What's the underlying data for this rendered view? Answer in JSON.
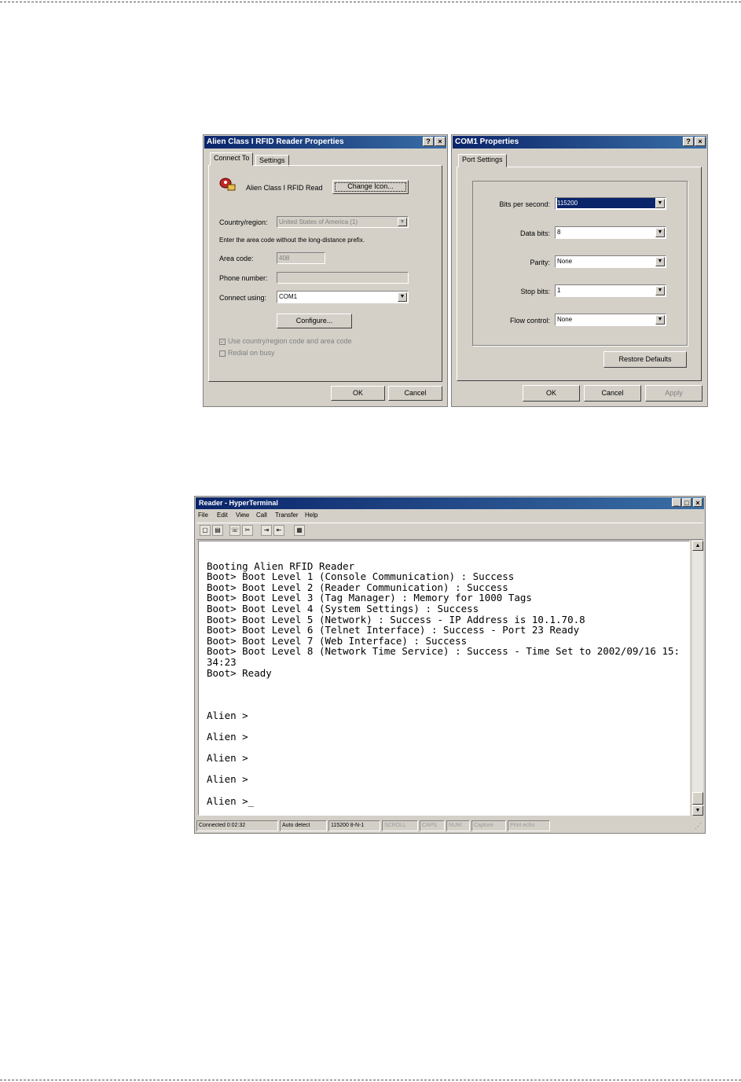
{
  "props_dialog": {
    "title": "Alien Class I RFID Reader Properties",
    "help_btn": "?",
    "close_btn": "×",
    "tabs": [
      "Connect To",
      "Settings"
    ],
    "connection_name": "Alien Class I RFID Read",
    "change_icon_label": "Change Icon...",
    "country_label": "Country/region:",
    "country_value": "United States of America (1)",
    "hint": "Enter the area code without the long-distance prefix.",
    "area_code_label": "Area code:",
    "area_code_value": "408",
    "phone_label": "Phone number:",
    "phone_value": "",
    "connect_using_label": "Connect using:",
    "connect_using_value": "COM1",
    "configure_label": "Configure...",
    "use_country_label": "Use country/region code and area code",
    "redial_label": "Redial on busy",
    "ok_label": "OK",
    "cancel_label": "Cancel"
  },
  "com_dialog": {
    "title": "COM1 Properties",
    "help_btn": "?",
    "close_btn": "×",
    "tab": "Port Settings",
    "fields": [
      {
        "label": "Bits per second:",
        "value": "115200"
      },
      {
        "label": "Data bits:",
        "value": "8"
      },
      {
        "label": "Parity:",
        "value": "None"
      },
      {
        "label": "Stop bits:",
        "value": "1"
      },
      {
        "label": "Flow control:",
        "value": "None"
      }
    ],
    "restore_label": "Restore Defaults",
    "ok_label": "OK",
    "cancel_label": "Cancel",
    "apply_label": "Apply"
  },
  "terminal": {
    "title": "Reader - HyperTerminal",
    "window_controls": [
      "_",
      "□",
      "×"
    ],
    "menu": [
      "File",
      "Edit",
      "View",
      "Call",
      "Transfer",
      "Help"
    ],
    "lines": [
      "",
      "Booting Alien RFID Reader",
      "Boot> Boot Level 1 (Console Communication) : Success",
      "Boot> Boot Level 2 (Reader Communication) : Success",
      "Boot> Boot Level 3 (Tag Manager) : Memory for 1000 Tags",
      "Boot> Boot Level 4 (System Settings) : Success",
      "Boot> Boot Level 5 (Network) : Success - IP Address is 10.1.70.8",
      "Boot> Boot Level 6 (Telnet Interface) : Success - Port 23 Ready",
      "Boot> Boot Level 7 (Web Interface) : Success",
      "Boot> Boot Level 8 (Network Time Service) : Success - Time Set to 2002/09/16 15:",
      "34:23",
      "Boot> Ready",
      "",
      "",
      "",
      "Alien >",
      "",
      "Alien >",
      "",
      "Alien >",
      "",
      "Alien >",
      "",
      "Alien >_"
    ],
    "status": [
      "Connected 0:02:32",
      "Auto detect",
      "115200 8-N-1",
      "SCROLL",
      "CAPS",
      "NUM",
      "Capture",
      "Print echo"
    ]
  }
}
